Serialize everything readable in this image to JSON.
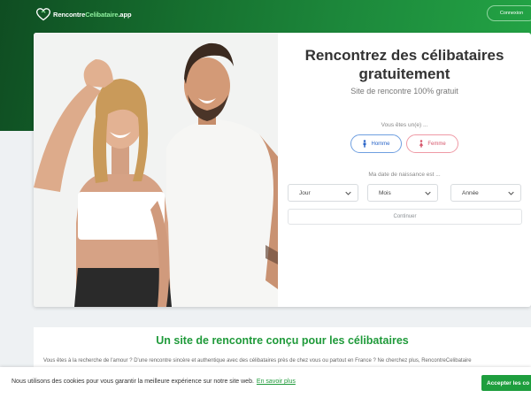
{
  "header": {
    "logo_text_main": "Rencontre",
    "logo_text_accent": "Celibataire",
    "logo_text_suffix": ".app",
    "connexion_label": "Connexion"
  },
  "hero": {
    "title_line1": "Rencontrez des célibataires",
    "title_line2": "gratuitement",
    "subtitle": "Site de rencontre 100% gratuit",
    "gender_label": "Vous êtes un(e) ...",
    "gender_options": [
      {
        "label": "Homme",
        "icon": "male-icon"
      },
      {
        "label": "Femme",
        "icon": "female-icon"
      }
    ],
    "dob_label": "Ma date de naissance est ...",
    "selects": [
      {
        "value": "Jour"
      },
      {
        "value": "Mois"
      },
      {
        "value": "Année"
      }
    ],
    "continue_label": "Continuer"
  },
  "section": {
    "title": "Un site de rencontre conçu pour les célibataires",
    "text": "Vous êtes à la recherche de l'amour ? D'une rencontre sincère et authentique avec des célibataires près de chez vous ou partout en France ? Ne cherchez plus, RencontreCelibataire"
  },
  "cookie": {
    "text": "Nous utilisons des cookies pour vous garantir la meilleure expérience sur notre site web.",
    "link": "En savoir plus",
    "accept_label": "Accepter les co"
  },
  "colors": {
    "brand_green": "#1e9e3e",
    "header_dark": "#0f4d22",
    "homme_blue": "#2a65c8",
    "femme_pink": "#d6556a"
  }
}
